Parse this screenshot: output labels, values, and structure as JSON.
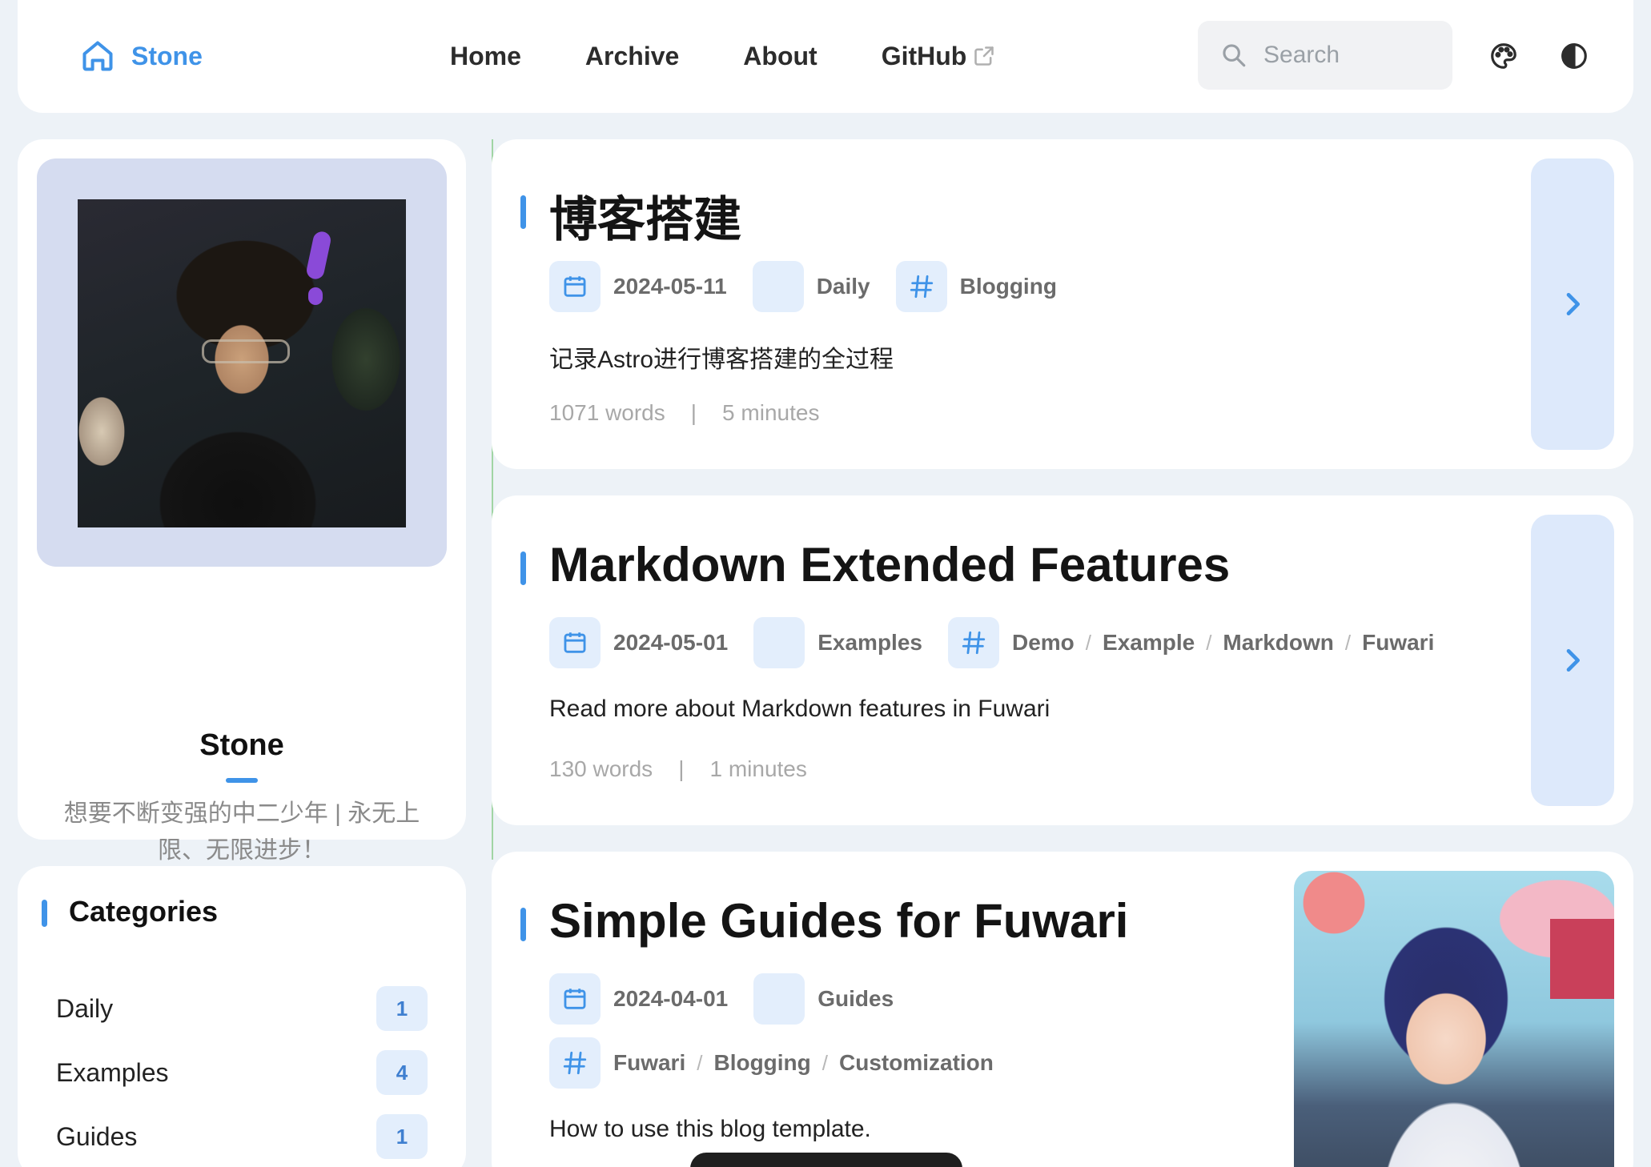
{
  "navbar": {
    "brand": "Stone",
    "links": [
      "Home",
      "Archive",
      "About",
      "GitHub"
    ],
    "search_placeholder": "Search"
  },
  "profile": {
    "name": "Stone",
    "bio": "想要不断变强的中二少年 | 永无上限、无限进步！"
  },
  "categories": {
    "title": "Categories",
    "items": [
      {
        "name": "Daily",
        "count": "1"
      },
      {
        "name": "Examples",
        "count": "4"
      },
      {
        "name": "Guides",
        "count": "1"
      }
    ]
  },
  "posts": [
    {
      "title": "博客搭建",
      "date": "2024-05-11",
      "category": "Daily",
      "tags": [
        "Blogging"
      ],
      "description": "记录Astro进行博客搭建的全过程",
      "words": "1071 words",
      "minutes": "5 minutes"
    },
    {
      "title": "Markdown Extended Features",
      "date": "2024-05-01",
      "category": "Examples",
      "tags": [
        "Demo",
        "Example",
        "Markdown",
        "Fuwari"
      ],
      "description": "Read more about Markdown features in Fuwari",
      "words": "130 words",
      "minutes": "1 minutes"
    },
    {
      "title": "Simple Guides for Fuwari",
      "date": "2024-04-01",
      "category": "Guides",
      "tags": [
        "Fuwari",
        "Blogging",
        "Customization"
      ],
      "description": "How to use this blog template."
    }
  ],
  "colors": {
    "accent": "#3f93e8",
    "background": "#edf2f7",
    "card": "#ffffff",
    "chip": "#e3eefc"
  },
  "icons": {
    "brand": "home-icon",
    "external": "external-link-icon",
    "search": "search-icon",
    "palette": "palette-icon",
    "theme": "contrast-icon",
    "twitter": "twitter-icon",
    "github": "github-icon",
    "date": "calendar-icon",
    "tag": "hash-icon",
    "arrow": "chevron-right-icon"
  }
}
